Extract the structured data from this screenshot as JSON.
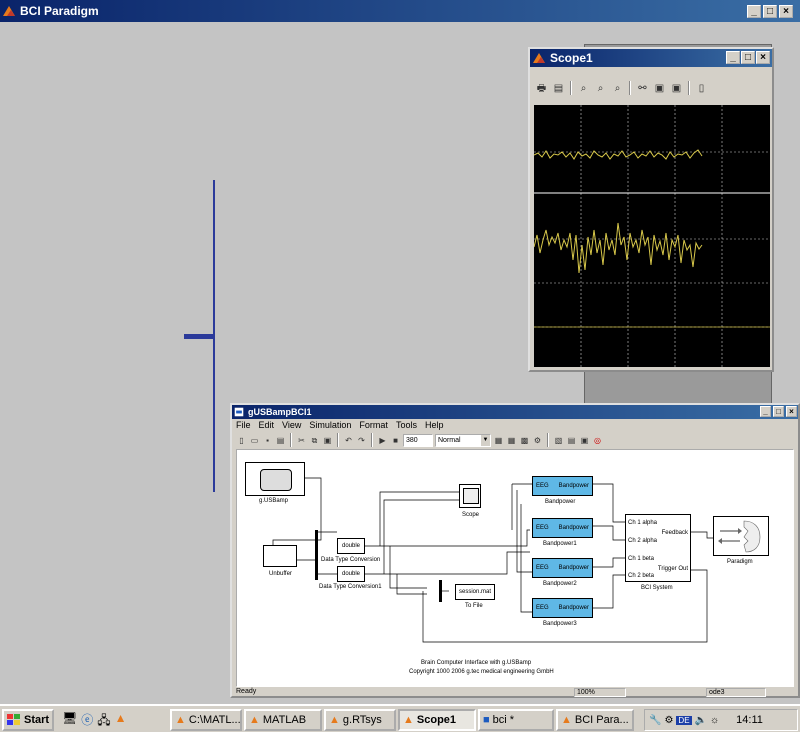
{
  "paradigm": {
    "title": "BCI Paradigm"
  },
  "scope": {
    "title": "Scope1"
  },
  "model": {
    "title": "gUSBampBCI1",
    "menu": [
      "File",
      "Edit",
      "View",
      "Simulation",
      "Format",
      "Tools",
      "Help"
    ],
    "stop_time": "380",
    "mode": "Normal",
    "blocks": {
      "usbamp": "g.USBamp",
      "unbuffer": "Unbuffer",
      "double1": "double",
      "double2": "double",
      "dtc1": "Data Type Conversion",
      "dtc2": "Data Type Conversion1",
      "scope": "Scope",
      "tofile": "session.mat",
      "tofile_label": "To File",
      "bp_in": "EEG",
      "bp_out": "Bandpower",
      "bp0": "Bandpower",
      "bp1": "Bandpower1",
      "bp2": "Bandpower2",
      "bp3": "Bandpower3",
      "ports": [
        "Ch 1 alpha",
        "Ch 2 alpha",
        "Ch 1 beta",
        "Ch 2 beta"
      ],
      "feedback": "Feedback",
      "trigger": "Trigger Out",
      "bci_system": "BCI System",
      "paradigm": "Paradigm"
    },
    "caption1": "Brain Computer Interface with g.USBamp",
    "caption2": "Copyright 1000 2006 g.tec medical engineering GmbH",
    "status": {
      "ready": "Ready",
      "zoom": "100%",
      "solver": "ode3"
    }
  },
  "taskbar": {
    "start": "Start",
    "tasks": [
      "C:\\MATL...",
      "MATLAB",
      "g.RTsys",
      "Scope1",
      "bci *",
      "BCI Para..."
    ],
    "lang": "DE",
    "clock": "14:11"
  },
  "colors": {
    "scope_trace": "#d8c84a",
    "titlebar": "#0a246a",
    "block_fill": "#5fb8e6"
  }
}
